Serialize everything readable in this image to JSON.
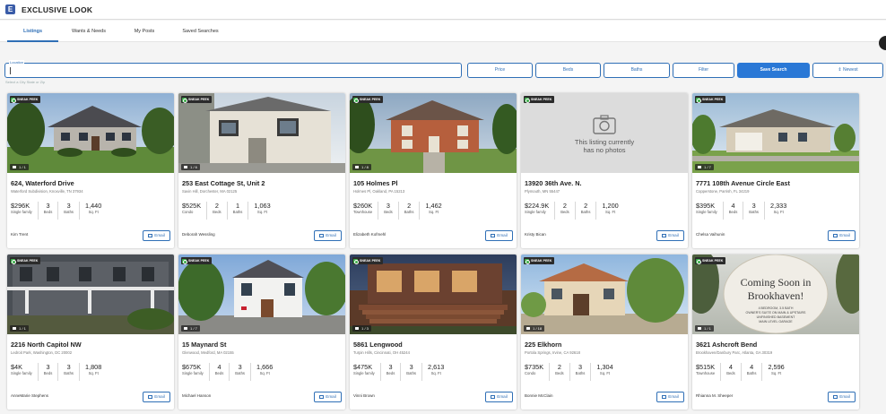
{
  "app": {
    "title": "EXCLUSIVE LOOK",
    "logo_letter": "E"
  },
  "tabs": [
    "Listings",
    "Wants & Needs",
    "My Posts",
    "Saved Searches"
  ],
  "filters": {
    "location_label": "Location",
    "location_value": "",
    "location_hint": "Select a City State or Zip",
    "price": "Price",
    "beds": "Beds",
    "baths": "Baths",
    "filter": "Filter",
    "save_search": "Save Search",
    "sort": "Newest",
    "sort_prefix": "⇕"
  },
  "labels": {
    "sneak_peek": "SNEAK PEEK",
    "email": "Email",
    "beds": "Beds",
    "baths": "Baths",
    "sqft": "Sq. Ft"
  },
  "no_photo": {
    "line1": "This listing currently",
    "line2": "has no photos"
  },
  "listings": [
    {
      "address": "624, Waterford Drive",
      "sub": "Waterford Subdivision, Knoxville, TN 37934",
      "photos": "1 / 1",
      "price": "$296K",
      "type": "Single family",
      "beds": "3",
      "baths": "3",
      "sqft": "1,440",
      "agent": "Kim Trent",
      "photo": "house1"
    },
    {
      "address": "253 East Cottage St, Unit 2",
      "sub": "Savin Hill, Dorchester, MA 02125",
      "photos": "1 / 6",
      "price": "$525K",
      "type": "Condo",
      "beds": "2",
      "baths": "1",
      "sqft": "1,063",
      "agent": "Deborah Wessling",
      "photo": "house2"
    },
    {
      "address": "105 Holmes Pl",
      "sub": "Holmes Pl, Oakland, PA 15213",
      "photos": "1 / 8",
      "price": "$260K",
      "type": "Townhouse",
      "beds": "3",
      "baths": "2",
      "sqft": "1,462",
      "agent": "Elizabeth Kofmehl",
      "photo": "house3"
    },
    {
      "address": "13920 36th Ave. N.",
      "sub": "Plymouth, MN 55447",
      "photos": "",
      "price": "$224.9K",
      "type": "Single family",
      "beds": "2",
      "baths": "2",
      "sqft": "1,200",
      "agent": "Kristy Bican",
      "photo": "none"
    },
    {
      "address": "7771 108th Avenue Circle East",
      "sub": "Copperstone, Parrish, FL 34219",
      "photos": "1 / 7",
      "price": "$395K",
      "type": "Single family",
      "beds": "4",
      "baths": "3",
      "sqft": "2,333",
      "agent": "Chelsa Vaihunin",
      "photo": "house5"
    },
    {
      "address": "2216 North Capitol NW",
      "sub": "Ledroit Park, Washington, DC 20002",
      "photos": "1 / 1",
      "price": "$4K",
      "type": "Single family",
      "beds": "3",
      "baths": "3",
      "sqft": "1,808",
      "agent": "AnneMarie Stephens",
      "photo": "house6"
    },
    {
      "address": "15 Maynard St",
      "sub": "Glenwood, Medford, MA 02155",
      "photos": "1 / 7",
      "price": "$675K",
      "type": "Single family",
      "beds": "4",
      "baths": "3",
      "sqft": "1,666",
      "agent": "Michael Hanson",
      "photo": "house7"
    },
    {
      "address": "5861 Lengwood",
      "sub": "Turpin Hills, Cincinnati, OH 45244",
      "photos": "1 / 3",
      "price": "$475K",
      "type": "Single family",
      "beds": "3",
      "baths": "3",
      "sqft": "2,613",
      "agent": "Vinni Brown",
      "photo": "house8"
    },
    {
      "address": "225 Elkhorn",
      "sub": "Portola Springs, Irvine, CA 92618",
      "photos": "1 / 18",
      "price": "$735K",
      "type": "Condo",
      "beds": "2",
      "baths": "3",
      "sqft": "1,304",
      "agent": "Bonnie McClain",
      "photo": "house9"
    },
    {
      "address": "3621 Ashcroft Bend",
      "sub": "Brookhaven/Danbury Parc, Atlanta, GA 30319",
      "photos": "1 / 1",
      "price": "$515K",
      "type": "Townhouse",
      "beds": "4",
      "baths": "4",
      "sqft": "2,596",
      "agent": "Rhianna M. Sheeper",
      "photo": "sign"
    }
  ],
  "sign": {
    "line1": "Coming Soon in",
    "line2": "Brookhaven!",
    "small1": "4 BEDROOM, 3.5 BATH",
    "small2": "OWNER'S SUITE ON MAIN & UPSTAIRS",
    "small3": "UNFINISHED BASEMENT",
    "small4": "MAIN LEVEL GARAGE"
  },
  "colors": {
    "accent": "#2f6fb6",
    "primary_button": "#2a78d6",
    "sneak_peek_icon": "#3cae4a"
  }
}
